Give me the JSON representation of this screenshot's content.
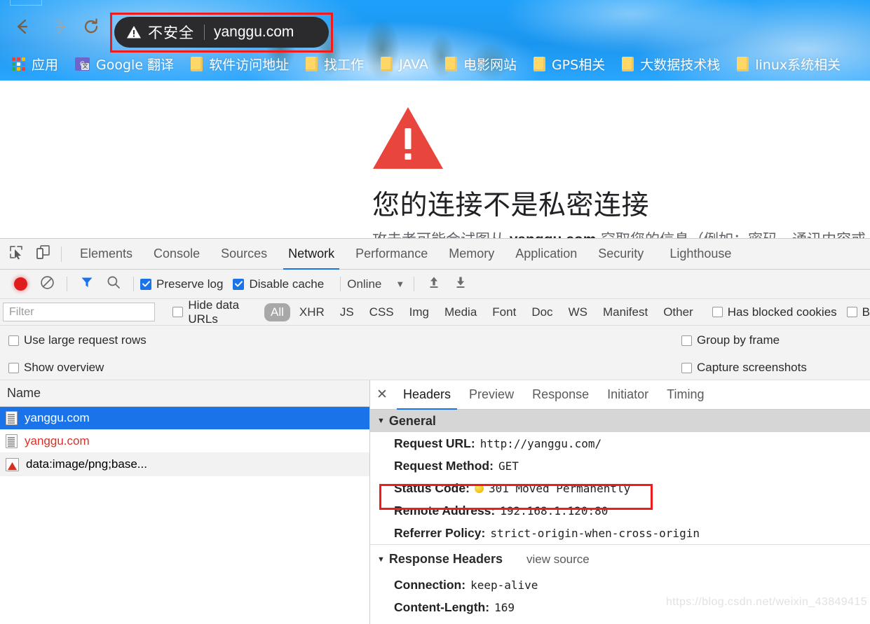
{
  "browser": {
    "nav": {
      "back_icon": "arrow-left-icon",
      "forward_icon": "arrow-right-icon",
      "reload_icon": "reload-icon"
    },
    "omnibox": {
      "security_icon": "warning-triangle-icon",
      "security_label": "不安全",
      "url": "yanggu.com",
      "highlight_color": "#ee1c1c"
    },
    "bookmarks": [
      {
        "label": "应用",
        "icon": "apps-grid-icon"
      },
      {
        "label": "Google 翻译",
        "icon": "google-translate-icon"
      },
      {
        "label": "软件访问地址",
        "icon": "folder-icon"
      },
      {
        "label": "找工作",
        "icon": "folder-icon"
      },
      {
        "label": "JAVA",
        "icon": "folder-icon"
      },
      {
        "label": "电影网站",
        "icon": "folder-icon"
      },
      {
        "label": "GPS相关",
        "icon": "folder-icon"
      },
      {
        "label": "大数据技术栈",
        "icon": "folder-icon"
      },
      {
        "label": "linux系统相关",
        "icon": "folder-icon"
      }
    ]
  },
  "page": {
    "warning_icon": "red-warning-triangle-icon",
    "heading": "您的连接不是私密连接",
    "subtext_before": "攻击者可能会试图从 ",
    "subtext_domain": "yanggu.com",
    "subtext_after": " 窃取您的信息（例如：密码、通讯内容或",
    "accent_color": "#e8453c"
  },
  "devtools": {
    "inspect_icon": "inspect-element-icon",
    "device_icon": "device-toolbar-icon",
    "tabs": [
      {
        "label": "Elements",
        "active": false
      },
      {
        "label": "Console",
        "active": false
      },
      {
        "label": "Sources",
        "active": false
      },
      {
        "label": "Network",
        "active": true
      },
      {
        "label": "Performance",
        "active": false
      },
      {
        "label": "Memory",
        "active": false
      },
      {
        "label": "Application",
        "active": false
      },
      {
        "label": "Security",
        "active": false
      },
      {
        "label": "Lighthouse",
        "active": false
      }
    ],
    "toolbar": {
      "record_icon": "record-button-icon",
      "clear_icon": "clear-icon",
      "filter_icon": "filter-funnel-icon",
      "search_icon": "search-icon",
      "preserve_log_label": "Preserve log",
      "preserve_log_checked": "true",
      "disable_cache_label": "Disable cache",
      "disable_cache_checked": "true",
      "throttling_value": "Online",
      "throttling_caret": "▼",
      "import_icon": "upload-arrow-icon",
      "export_icon": "download-arrow-icon"
    },
    "filterbar": {
      "filter_placeholder": "Filter",
      "filter_value": "",
      "hide_data_urls_label": "Hide data URLs",
      "chips": [
        "All",
        "XHR",
        "JS",
        "CSS",
        "Img",
        "Media",
        "Font",
        "Doc",
        "WS",
        "Manifest",
        "Other"
      ],
      "selected_chip": "All",
      "has_blocked_cookies_label": "Has blocked cookies",
      "blocked_requests_label": "B"
    },
    "settings": {
      "use_large_rows_label": "Use large request rows",
      "show_overview_label": "Show overview",
      "group_by_frame_label": "Group by frame",
      "capture_screenshots_label": "Capture screenshots"
    },
    "requests": {
      "column_header": "Name",
      "rows": [
        {
          "name": "yanggu.com",
          "icon": "document-icon",
          "state": "selected"
        },
        {
          "name": "yanggu.com",
          "icon": "document-icon",
          "state": "error"
        },
        {
          "name": "data:image/png;base...",
          "icon": "image-triangle-icon",
          "state": "normal"
        }
      ]
    },
    "details": {
      "close_icon": "close-icon",
      "tabs": [
        {
          "label": "Headers",
          "active": true
        },
        {
          "label": "Preview",
          "active": false
        },
        {
          "label": "Response",
          "active": false
        },
        {
          "label": "Initiator",
          "active": false
        },
        {
          "label": "Timing",
          "active": false
        }
      ],
      "general": {
        "title": "General",
        "caret": "▼",
        "items": [
          {
            "key": "Request URL:",
            "value": "http://yanggu.com/"
          },
          {
            "key": "Request Method:",
            "value": "GET"
          },
          {
            "key": "Status Code:",
            "value": "301 Moved Permanently",
            "dot": "yellow-status-dot",
            "highlighted": "true"
          },
          {
            "key": "Remote Address:",
            "value": "192.168.1.120:80"
          },
          {
            "key": "Referrer Policy:",
            "value": "strict-origin-when-cross-origin"
          }
        ]
      },
      "response_headers": {
        "title": "Response Headers",
        "caret": "▼",
        "view_source_label": "view source",
        "items": [
          {
            "key": "Connection:",
            "value": "keep-alive"
          },
          {
            "key": "Content-Length:",
            "value": "169"
          }
        ]
      }
    }
  },
  "watermark": "https://blog.csdn.net/weixin_43849415"
}
